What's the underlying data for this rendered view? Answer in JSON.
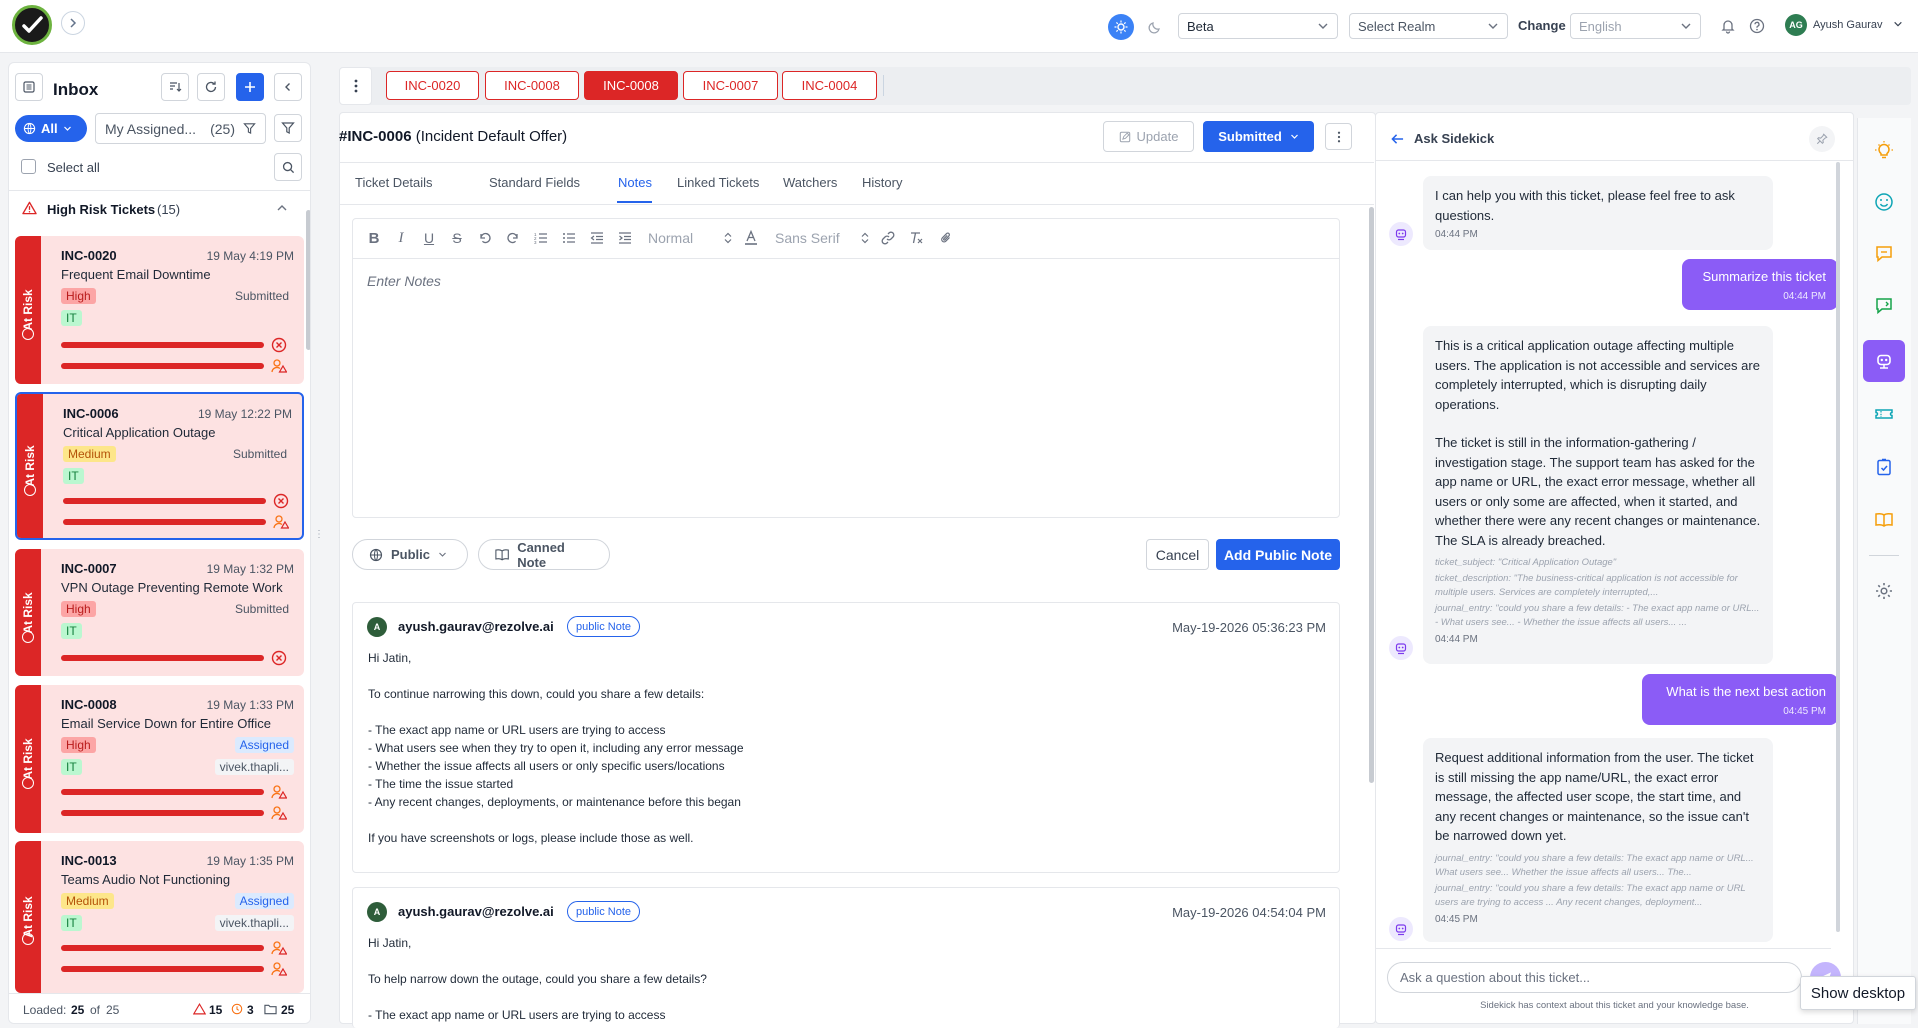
{
  "topbar": {
    "environment_select": "Beta",
    "realm_placeholder": "Select Realm",
    "change_label": "Change",
    "language_select": "English",
    "user_initials": "AG",
    "user_name": "Ayush Gaurav"
  },
  "inbox": {
    "title": "Inbox",
    "filter_all": "All",
    "my_assigned": "My Assigned...",
    "my_assigned_count": "(25)",
    "select_all": "Select all",
    "group_title": "High Risk Tickets",
    "group_count": "(15)",
    "risk_label": "At Risk",
    "cards": [
      {
        "id": "INC-0020",
        "date": "19 May 4:19 PM",
        "title": "Frequent Email Downtime",
        "priority": "High",
        "status": "Submitted",
        "dept": "IT"
      },
      {
        "id": "INC-0006",
        "date": "19 May 12:22 PM",
        "title": "Critical Application Outage",
        "priority": "Medium",
        "status": "Submitted",
        "dept": "IT"
      },
      {
        "id": "INC-0007",
        "date": "19 May 1:32 PM",
        "title": "VPN Outage Preventing Remote Work",
        "priority": "High",
        "status": "Submitted",
        "dept": "IT"
      },
      {
        "id": "INC-0008",
        "date": "19 May 1:33 PM",
        "title": "Email Service Down for Entire Office",
        "priority": "High",
        "status": "Assigned",
        "dept": "IT",
        "assignee": "vivek.thapli..."
      },
      {
        "id": "INC-0013",
        "date": "19 May 1:35 PM",
        "title": "Teams Audio Not Functioning",
        "priority": "Medium",
        "status": "Assigned",
        "dept": "IT",
        "assignee": "vivek.thapli..."
      }
    ],
    "footer": {
      "loaded_label": "Loaded:",
      "loaded": "25",
      "of_label": "of",
      "total": "25",
      "risk_count": "15",
      "warn_count": "3",
      "folder_count": "25"
    }
  },
  "tabs": [
    "INC-0020",
    "INC-0008",
    "INC-0008",
    "INC-0007",
    "INC-0004"
  ],
  "active_tab_index": 2,
  "ticket": {
    "id": "#INC-0006",
    "subtitle": "(Incident Default Offer)",
    "update_label": "Update",
    "status_label": "Submitted",
    "subtabs": [
      "Ticket Details",
      "Standard Fields",
      "Notes",
      "Linked Tickets",
      "Watchers",
      "History"
    ],
    "active_subtab": "Notes"
  },
  "editor": {
    "format_select": "Normal",
    "font_select": "Sans Serif",
    "placeholder": "Enter Notes",
    "visibility_label": "Public",
    "canned_label": "Canned Note",
    "cancel_label": "Cancel",
    "add_label": "Add Public Note"
  },
  "notes": [
    {
      "initial": "A",
      "author": "ayush.gaurav@rezolve.ai",
      "tag": "public Note",
      "date": "May-19-2026 05:36:23 PM",
      "lines": [
        "Hi Jatin,",
        "To continue narrowing this down, could you share a few details:",
        "- The exact app name or URL users are trying to access",
        "- What users see when they try to open it, including any error message",
        "- Whether the issue affects all users or only specific users/locations",
        "- The time the issue started",
        "- Any recent changes, deployments, or maintenance before this began",
        "If you have screenshots or logs, please include those as well."
      ]
    },
    {
      "initial": "A",
      "author": "ayush.gaurav@rezolve.ai",
      "tag": "public Note",
      "date": "May-19-2026 04:54:04 PM",
      "lines": [
        "Hi Jatin,",
        "To help narrow down the outage, could you share a few details?",
        "- The exact app name or URL users are trying to access"
      ]
    }
  ],
  "sidekick": {
    "title": "Ask Sidekick",
    "messages": [
      {
        "text": "I can help you with this ticket, please feel free to ask questions.",
        "time": "04:44 PM"
      },
      {
        "text": "Summarize this ticket",
        "time": "04:44 PM"
      },
      {
        "p1": "This is a critical application outage affecting multiple users. The application is not accessible and services are completely interrupted, which is disrupting daily operations.",
        "p2": "The ticket is still in the information-gathering / investigation stage. The support team has asked for the app name or URL, the exact error message, whether all users or only some are affected, when it started, and whether there were any recent changes or maintenance. The SLA is already breached.",
        "ctx1": "ticket_subject: \"Critical Application Outage\"",
        "ctx2": "ticket_description: \"The business-critical application is not accessible for multiple users. Services are completely interrupted,...",
        "ctx3": "journal_entry: \"could you share a few details: - The exact app name or URL... - What users see... - Whether the issue affects all users... ...",
        "time": "04:44 PM"
      },
      {
        "text": "What is the next best action",
        "time": "04:45 PM"
      },
      {
        "text": "Request additional information from the user. The ticket is still missing the app name/URL, the exact error message, the affected user scope, the start time, and any recent changes or maintenance, so the issue can't be narrowed down yet.",
        "ctx1": "journal_entry: \"could you share a few details: The exact app name or URL... What users see... Whether the issue affects all users... The...",
        "ctx2": "journal_entry: \"could you share a few details: The exact app name or URL users are trying to access ... Any recent changes, deployment...",
        "time": "04:45 PM"
      }
    ],
    "input_placeholder": "Ask a question about this ticket...",
    "footer": "Sidekick has context about this ticket and your knowledge base."
  },
  "tooltip": "Show desktop",
  "colors": {
    "accent": "#2563eb",
    "risk": "#dc2626",
    "card_bg": "#fde2e2",
    "sidekick": "#8b5cf6"
  }
}
